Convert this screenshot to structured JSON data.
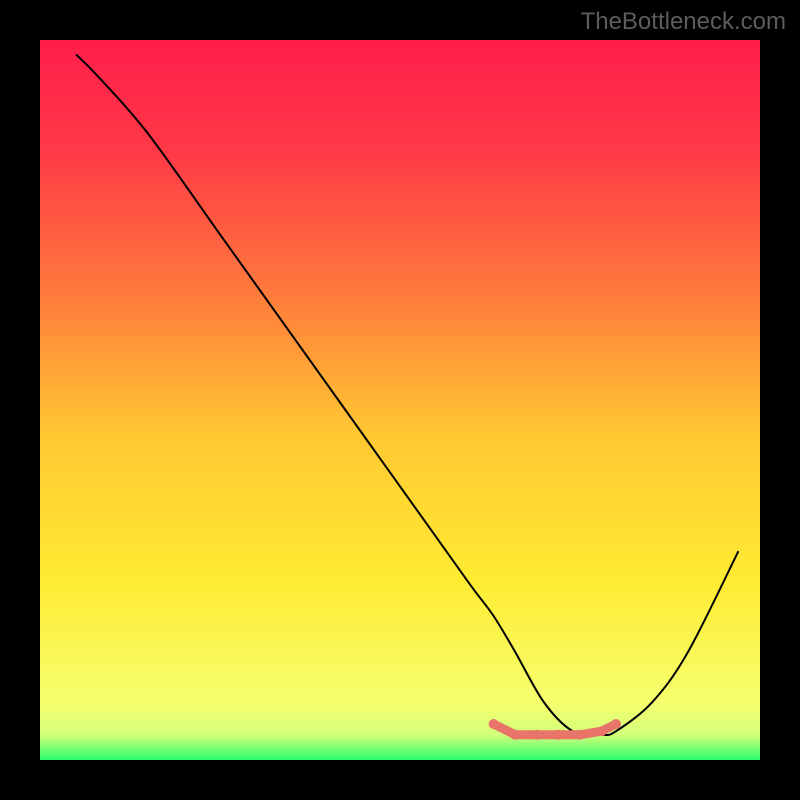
{
  "watermark_text": "TheBottleneck.com",
  "chart_data": {
    "type": "line",
    "title": "",
    "xlabel": "",
    "ylabel": "",
    "ylim": [
      0,
      100
    ],
    "xlim": [
      0,
      100
    ],
    "x": [
      5,
      8,
      15,
      25,
      35,
      45,
      55,
      60,
      63,
      66,
      70,
      74,
      78,
      80,
      85,
      90,
      97
    ],
    "values": [
      98,
      95,
      87,
      73,
      59,
      45,
      31,
      24,
      20,
      15,
      8,
      4,
      3.5,
      4,
      8,
      15,
      29
    ],
    "marker_points": [
      {
        "x": 63,
        "y": 5
      },
      {
        "x": 66,
        "y": 3.5
      },
      {
        "x": 69,
        "y": 3.5
      },
      {
        "x": 72,
        "y": 3.5
      },
      {
        "x": 75,
        "y": 3.5
      },
      {
        "x": 78,
        "y": 4
      },
      {
        "x": 80,
        "y": 5
      }
    ],
    "gradient_stops": [
      {
        "pos": 0.0,
        "color": "#ff1e4a"
      },
      {
        "pos": 0.15,
        "color": "#ff3847"
      },
      {
        "pos": 0.35,
        "color": "#ff7a3c"
      },
      {
        "pos": 0.55,
        "color": "#ffc832"
      },
      {
        "pos": 0.75,
        "color": "#ffeb32"
      },
      {
        "pos": 0.92,
        "color": "#f5ff6e"
      },
      {
        "pos": 0.965,
        "color": "#d4ff7a"
      },
      {
        "pos": 1.0,
        "color": "#2bff6e"
      }
    ]
  }
}
